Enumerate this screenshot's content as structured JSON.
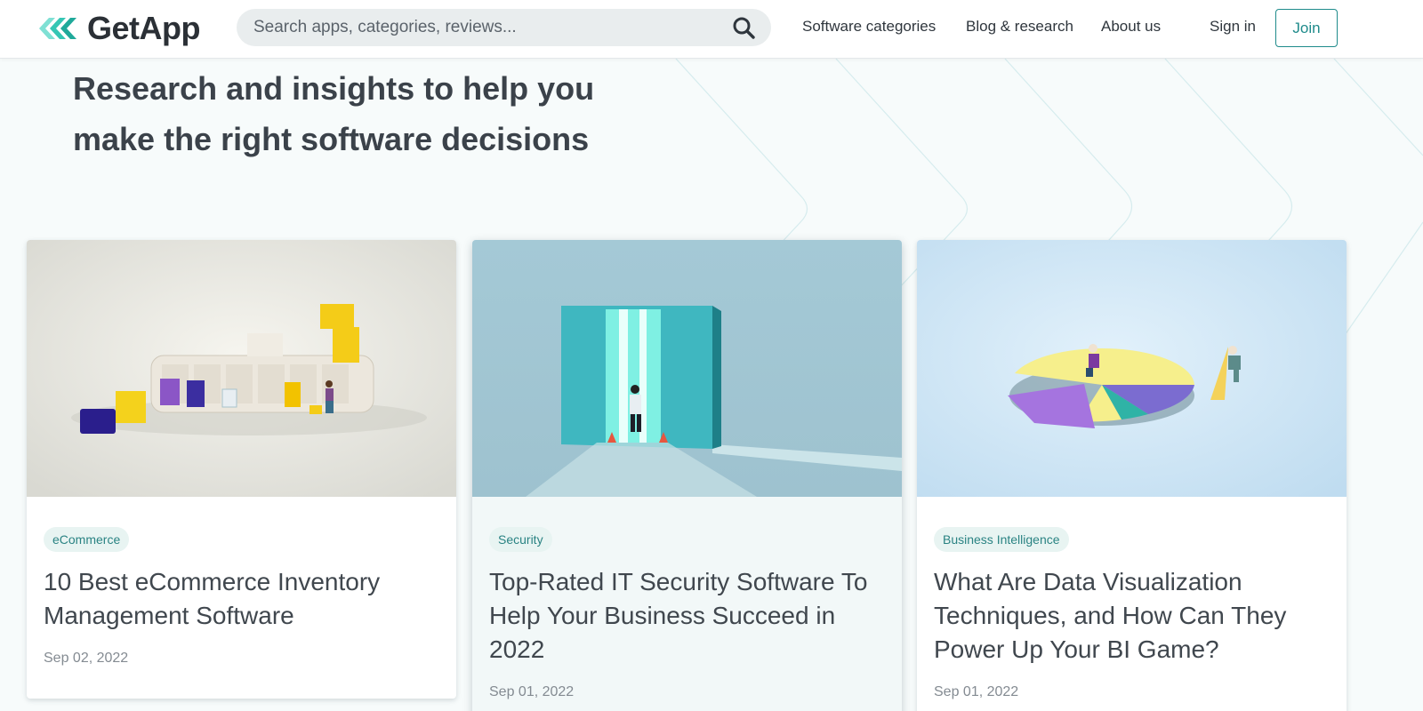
{
  "header": {
    "logo_text": "GetApp",
    "search_placeholder": "Search apps, categories, reviews...",
    "nav": {
      "software_categories": "Software categories",
      "blog_research": "Blog & research",
      "about_us": "About us",
      "sign_in": "Sign in",
      "join": "Join"
    }
  },
  "hero": {
    "line1": "Research and insights to help you",
    "line2": "make the right software decisions"
  },
  "cards": [
    {
      "tag": "eCommerce",
      "title": "10 Best eCommerce Inventory Management Software",
      "date": "Sep 02, 2022",
      "image": "ecommerce-shelves-illustration"
    },
    {
      "tag": "Security",
      "title": "Top-Rated IT Security Software To Help Your Business Succeed in 2022",
      "date": "Sep 01, 2022",
      "image": "security-doorway-guard-illustration"
    },
    {
      "tag": "Business Intelligence",
      "title": "What Are Data Visualization Techniques, and How Can They Power Up Your BI Game?",
      "date": "Sep 01, 2022",
      "image": "pie-chart-figures-illustration"
    }
  ],
  "colors": {
    "accent": "#1f8b8b",
    "logo_teal": "#35c6b4",
    "background": "#f7fbfb"
  }
}
